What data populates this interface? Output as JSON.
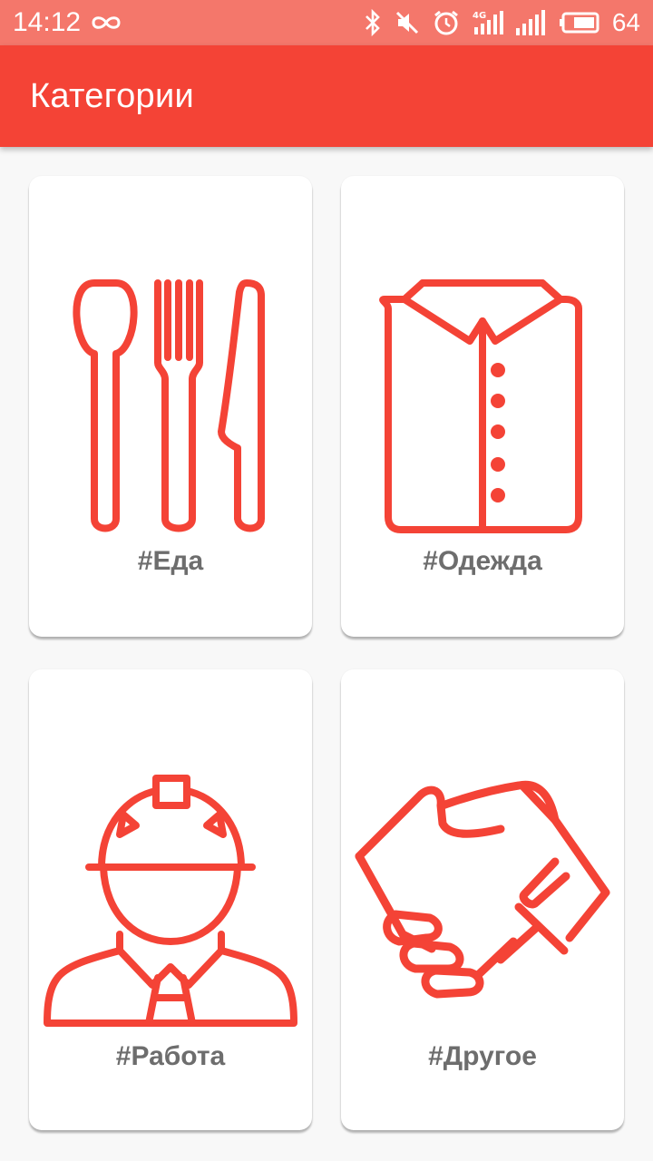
{
  "status_bar": {
    "time": "14:12",
    "battery_level": "64",
    "icons": [
      "infinity-icon",
      "bluetooth-icon",
      "mute-icon",
      "alarm-icon",
      "signal-4g-icon",
      "signal-icon",
      "battery-icon"
    ]
  },
  "app_bar": {
    "title": "Категории",
    "color": "#f44336"
  },
  "categories": [
    {
      "label": "#Еда",
      "icon": "cutlery-icon"
    },
    {
      "label": "#Одежда",
      "icon": "shirt-icon"
    },
    {
      "label": "#Работа",
      "icon": "worker-icon"
    },
    {
      "label": "#Другое",
      "icon": "handshake-icon"
    }
  ],
  "accent_color": "#f44336"
}
